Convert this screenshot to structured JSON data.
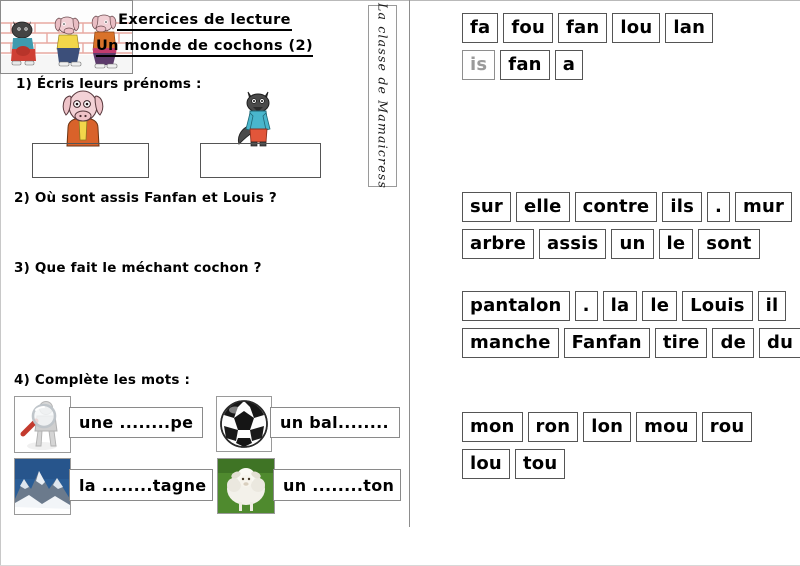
{
  "worksheet": {
    "title_main": "Exercices de lecture",
    "title_sub": "Un monde de cochons (2)",
    "credit": "La classe de Mamaicress",
    "questions": [
      {
        "id": "q1",
        "text": "1)  Écris leurs prénoms :"
      },
      {
        "id": "q2",
        "text": "2) Où sont assis Fanfan et Louis ?"
      },
      {
        "id": "q3",
        "text": "3) Que fait le méchant cochon ?"
      },
      {
        "id": "q4",
        "text": "4) Complète les mots :"
      }
    ],
    "answer_boxes": [
      {
        "name": "answer-box-pig",
        "value": ""
      },
      {
        "name": "answer-box-wolf",
        "value": ""
      }
    ],
    "illustrations": [
      {
        "name": "pig-character-illustration",
        "alt": "cochon"
      },
      {
        "name": "wolf-character-illustration",
        "alt": "loup"
      },
      {
        "name": "scene-illustration",
        "alt": "le loup et les cochons devant un mur de briques"
      }
    ],
    "complete_words": [
      {
        "image": "magnifying-glass-thumbnail",
        "text": "une ........pe"
      },
      {
        "image": "soccer-ball-thumbnail",
        "text": "un bal........"
      },
      {
        "image": "mountain-thumbnail",
        "text": "la ........tagne"
      },
      {
        "image": "sheep-thumbnail",
        "text": "un ........ton"
      }
    ]
  },
  "word_bank": {
    "groups": [
      {
        "name": "syllables-group",
        "rows": [
          [
            {
              "label": "fa",
              "dim": false
            },
            {
              "label": "fou",
              "dim": false
            },
            {
              "label": "fan",
              "dim": false
            },
            {
              "label": "lou",
              "dim": false
            },
            {
              "label": "lan",
              "dim": false
            }
          ],
          [
            {
              "label": "is",
              "dim": true
            },
            {
              "label": "fan",
              "dim": false
            },
            {
              "label": "a",
              "dim": false
            }
          ]
        ]
      },
      {
        "name": "sentence-words-group-1",
        "rows": [
          [
            {
              "label": "sur",
              "dim": false
            },
            {
              "label": "elle",
              "dim": false
            },
            {
              "label": "contre",
              "dim": false
            },
            {
              "label": "ils",
              "dim": false
            },
            {
              "label": ".",
              "dim": false
            },
            {
              "label": "mur",
              "dim": false
            }
          ],
          [
            {
              "label": "arbre",
              "dim": false
            },
            {
              "label": "assis",
              "dim": false
            },
            {
              "label": "un",
              "dim": false
            },
            {
              "label": "le",
              "dim": false
            },
            {
              "label": "sont",
              "dim": false
            }
          ]
        ]
      },
      {
        "name": "sentence-words-group-2",
        "rows": [
          [
            {
              "label": "pantalon",
              "dim": false
            },
            {
              "label": ".",
              "dim": false
            },
            {
              "label": "la",
              "dim": false
            },
            {
              "label": "le",
              "dim": false
            },
            {
              "label": "Louis",
              "dim": false
            },
            {
              "label": "il",
              "dim": false
            }
          ],
          [
            {
              "label": "manche",
              "dim": false
            },
            {
              "label": "Fanfan",
              "dim": false
            },
            {
              "label": "tire",
              "dim": false
            },
            {
              "label": "de",
              "dim": false
            },
            {
              "label": "du",
              "dim": false
            }
          ]
        ]
      },
      {
        "name": "syllables-group-2",
        "rows": [
          [
            {
              "label": "mon",
              "dim": false
            },
            {
              "label": "ron",
              "dim": false
            },
            {
              "label": "lon",
              "dim": false
            },
            {
              "label": "mou",
              "dim": false
            },
            {
              "label": "rou",
              "dim": false
            }
          ],
          [
            {
              "label": "lou",
              "dim": false
            },
            {
              "label": "tou",
              "dim": false
            }
          ]
        ]
      }
    ]
  },
  "colors": {
    "pig_skin": "#f3d2d6",
    "pig_coat": "#d9622a",
    "pig_shirt": "#f2d64a",
    "wolf_fur": "#4a4a4a",
    "wolf_shirt": "#49b6cc",
    "wolf_pants": "#e2563a",
    "brick": "#e8a9a2",
    "line": "#555555"
  }
}
